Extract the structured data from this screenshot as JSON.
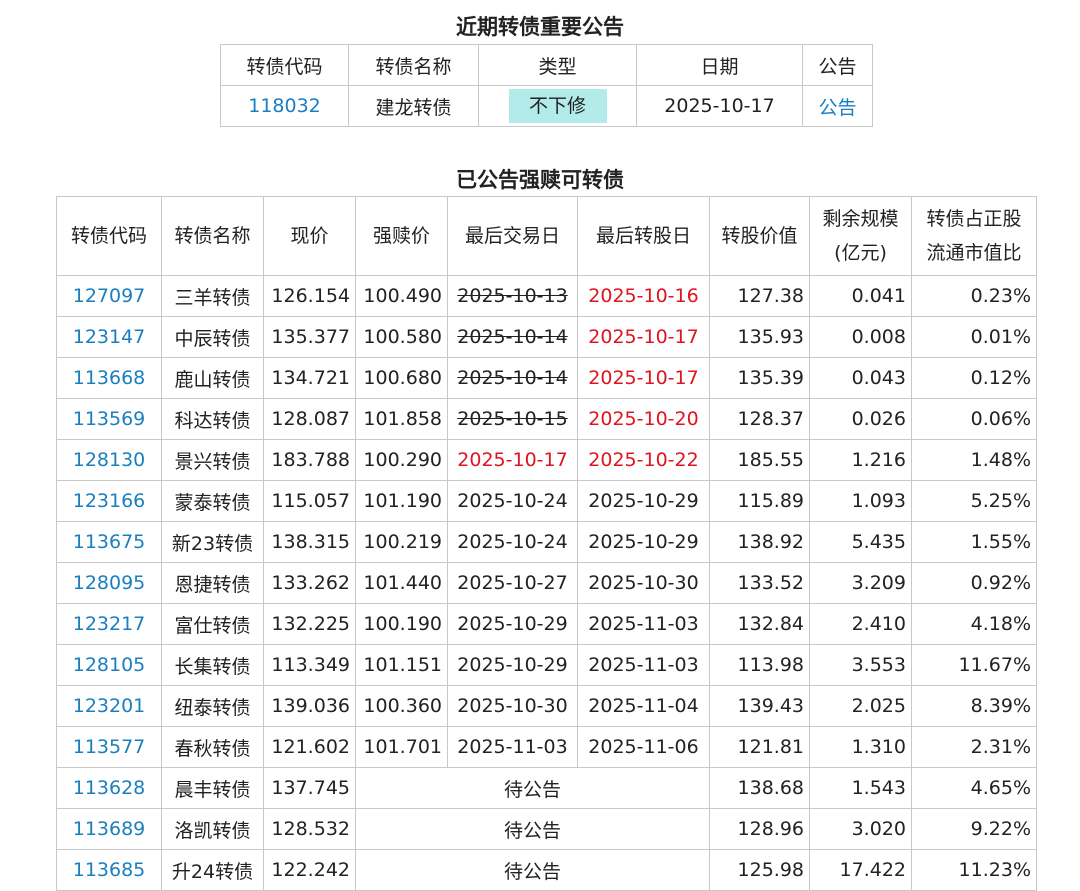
{
  "announce": {
    "title": "近期转债重要公告",
    "headers": [
      "转债代码",
      "转债名称",
      "类型",
      "日期",
      "公告"
    ],
    "rows": [
      {
        "code": "118032",
        "name": "建龙转债",
        "type": "不下修",
        "date": "2025-10-17",
        "link": "公告"
      }
    ],
    "tag_color": "#b3ebeb"
  },
  "redeem": {
    "title": "已公告强赎可转债",
    "headers": {
      "code": "转债代码",
      "name": "转债名称",
      "price": "现价",
      "redeem_price": "强赎价",
      "last_trade": "最后交易日",
      "last_convert": "最后转股日",
      "conv_value": "转股价值",
      "remain_line1": "剩余规模",
      "remain_line2": "(亿元)",
      "ratio_line1": "转债占正股",
      "ratio_line2": "流通市值比"
    },
    "rows": [
      {
        "code": "127097",
        "name": "三羊转债",
        "price": "126.154",
        "redeem_price": "100.490",
        "last_trade": "2025-10-13",
        "last_convert": "2025-10-16",
        "conv_value": "127.38",
        "remain": "0.041",
        "ratio": "0.23%"
      },
      {
        "code": "123147",
        "name": "中辰转债",
        "price": "135.377",
        "redeem_price": "100.580",
        "last_trade": "2025-10-14",
        "last_convert": "2025-10-17",
        "conv_value": "135.93",
        "remain": "0.008",
        "ratio": "0.01%"
      },
      {
        "code": "113668",
        "name": "鹿山转债",
        "price": "134.721",
        "redeem_price": "100.680",
        "last_trade": "2025-10-14",
        "last_convert": "2025-10-17",
        "conv_value": "135.39",
        "remain": "0.043",
        "ratio": "0.12%"
      },
      {
        "code": "113569",
        "name": "科达转债",
        "price": "128.087",
        "redeem_price": "101.858",
        "last_trade": "2025-10-15",
        "last_convert": "2025-10-20",
        "conv_value": "128.37",
        "remain": "0.026",
        "ratio": "0.06%"
      },
      {
        "code": "128130",
        "name": "景兴转债",
        "price": "183.788",
        "redeem_price": "100.290",
        "last_trade": "2025-10-17",
        "last_convert": "2025-10-22",
        "conv_value": "185.55",
        "remain": "1.216",
        "ratio": "1.48%"
      },
      {
        "code": "123166",
        "name": "蒙泰转债",
        "price": "115.057",
        "redeem_price": "101.190",
        "last_trade": "2025-10-24",
        "last_convert": "2025-10-29",
        "conv_value": "115.89",
        "remain": "1.093",
        "ratio": "5.25%"
      },
      {
        "code": "113675",
        "name": "新23转债",
        "price": "138.315",
        "redeem_price": "100.219",
        "last_trade": "2025-10-24",
        "last_convert": "2025-10-29",
        "conv_value": "138.92",
        "remain": "5.435",
        "ratio": "1.55%"
      },
      {
        "code": "128095",
        "name": "恩捷转债",
        "price": "133.262",
        "redeem_price": "101.440",
        "last_trade": "2025-10-27",
        "last_convert": "2025-10-30",
        "conv_value": "133.52",
        "remain": "3.209",
        "ratio": "0.92%"
      },
      {
        "code": "123217",
        "name": "富仕转债",
        "price": "132.225",
        "redeem_price": "100.190",
        "last_trade": "2025-10-29",
        "last_convert": "2025-11-03",
        "conv_value": "132.84",
        "remain": "2.410",
        "ratio": "4.18%"
      },
      {
        "code": "128105",
        "name": "长集转债",
        "price": "113.349",
        "redeem_price": "101.151",
        "last_trade": "2025-10-29",
        "last_convert": "2025-11-03",
        "conv_value": "113.98",
        "remain": "3.553",
        "ratio": "11.67%"
      },
      {
        "code": "123201",
        "name": "纽泰转债",
        "price": "139.036",
        "redeem_price": "100.360",
        "last_trade": "2025-10-30",
        "last_convert": "2025-11-04",
        "conv_value": "139.43",
        "remain": "2.025",
        "ratio": "8.39%"
      },
      {
        "code": "113577",
        "name": "春秋转债",
        "price": "121.602",
        "redeem_price": "101.701",
        "last_trade": "2025-11-03",
        "last_convert": "2025-11-06",
        "conv_value": "121.81",
        "remain": "1.310",
        "ratio": "2.31%"
      },
      {
        "code": "113628",
        "name": "晨丰转债",
        "price": "137.745",
        "pending": "待公告",
        "conv_value": "138.68",
        "remain": "1.543",
        "ratio": "4.65%"
      },
      {
        "code": "113689",
        "name": "洛凯转债",
        "price": "128.532",
        "pending": "待公告",
        "conv_value": "128.96",
        "remain": "3.020",
        "ratio": "9.22%"
      },
      {
        "code": "113685",
        "name": "升24转债",
        "price": "122.242",
        "pending": "待公告",
        "conv_value": "125.98",
        "remain": "17.422",
        "ratio": "11.23%"
      }
    ],
    "colors": {
      "link": "#1a7fc1",
      "highlight_red": "#e0141e"
    }
  }
}
